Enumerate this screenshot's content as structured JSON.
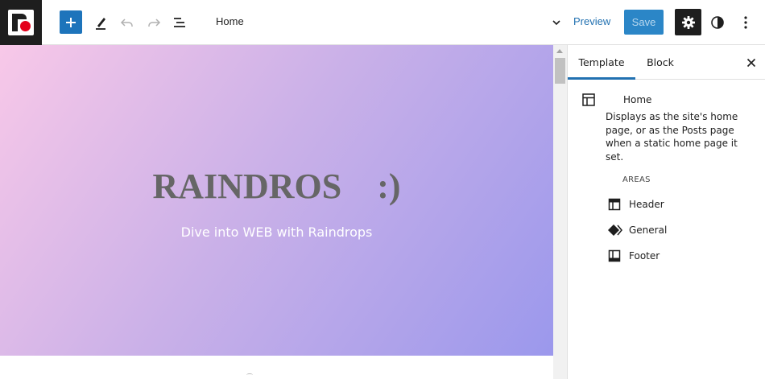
{
  "header": {
    "document_title": "Home",
    "preview_label": "Preview",
    "save_label": "Save",
    "colors": {
      "primary": "#1d74bb",
      "save": "#2b86c7",
      "dark": "#1e1e1e",
      "logo_dot": "#e3001b"
    }
  },
  "canvas": {
    "hero": {
      "title": "RAINDROS    :)",
      "subtitle": "Dive into WEB with Raindrops",
      "gradient": [
        "#f8c8e8",
        "#cbb1e8",
        "#9b98ec"
      ]
    }
  },
  "sidebar": {
    "tabs": [
      {
        "label": "Template",
        "active": true
      },
      {
        "label": "Block",
        "active": false
      }
    ],
    "template": {
      "name": "Home",
      "description": "Displays as the site's home page, or as the Posts page when a static home page it set."
    },
    "areas_label": "AREAS",
    "areas": [
      {
        "label": "Header",
        "icon": "header-area-icon"
      },
      {
        "label": "General",
        "icon": "general-area-icon"
      },
      {
        "label": "Footer",
        "icon": "footer-area-icon"
      }
    ]
  }
}
